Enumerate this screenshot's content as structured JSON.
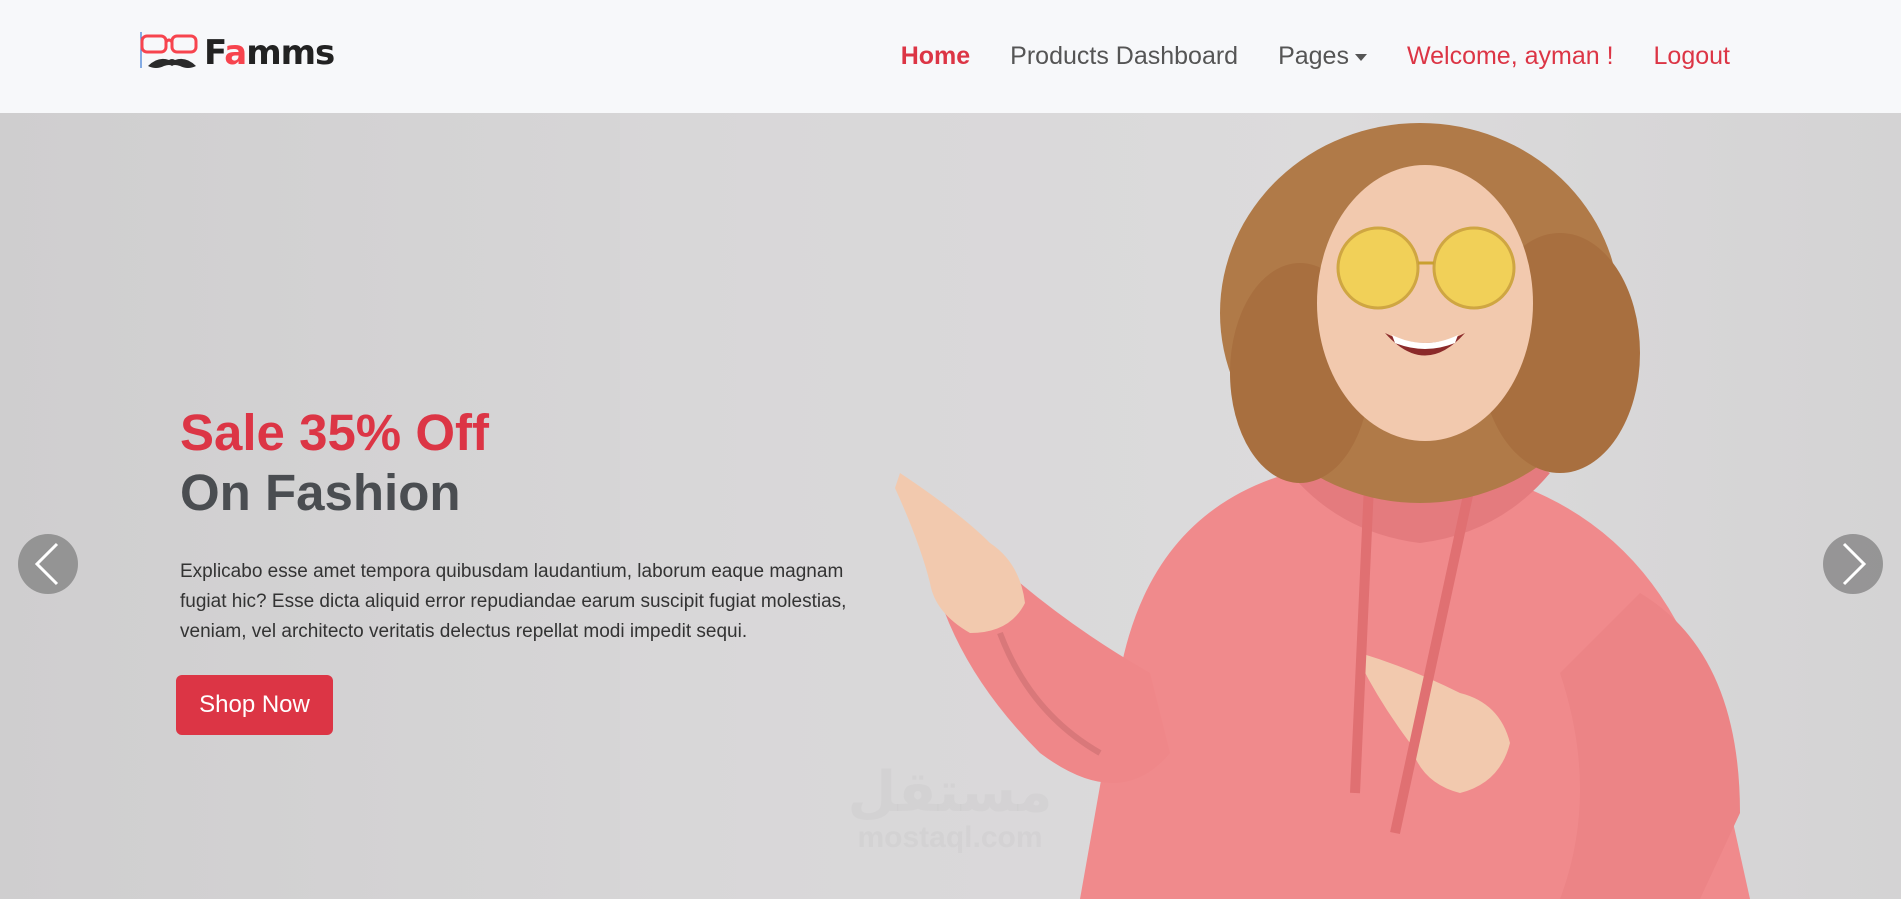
{
  "brand": {
    "name_prefix": "F",
    "name_accent": "a",
    "name_suffix": "mms"
  },
  "nav": {
    "items": [
      {
        "label": "Home",
        "active": true
      },
      {
        "label": "Products Dashboard"
      },
      {
        "label": "Pages",
        "dropdown": true
      },
      {
        "label": "Welcome, ayman !"
      },
      {
        "label": "Logout"
      }
    ]
  },
  "hero": {
    "headline_1": "Sale 35% Off",
    "headline_2": "On Fashion",
    "description": "Explicabo esse amet tempora quibusdam laudantium, laborum eaque magnam fugiat hic? Esse dicta aliquid error repudiandae earum suscipit fugiat molestias, veniam, vel architecto veritatis delectus repellat modi impedit sequi.",
    "cta_label": "Shop Now"
  },
  "carousel": {
    "prev_icon": "chevron-left-icon",
    "next_icon": "chevron-right-icon"
  },
  "watermark": {
    "arabic": "مستقل",
    "latin": "mostaql.com"
  },
  "colors": {
    "accent": "#dc3545",
    "brand_accent": "#f7444e",
    "navbar_bg": "#f7f8fa",
    "hoodie": "#f08a8c",
    "hair": "#b07a48"
  }
}
